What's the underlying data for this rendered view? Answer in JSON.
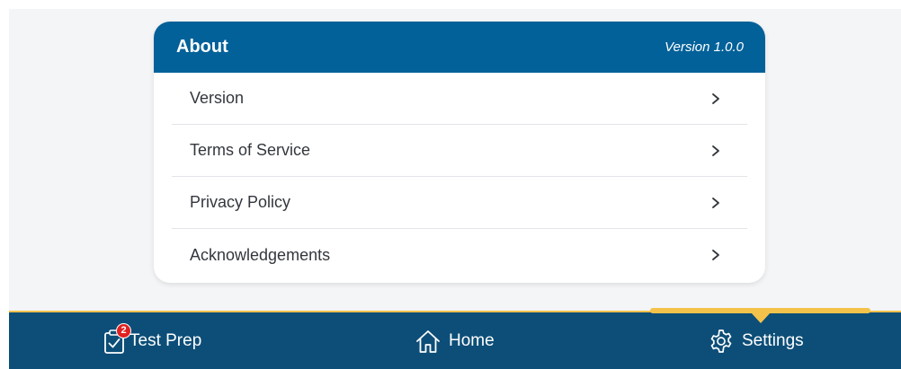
{
  "about_card": {
    "title": "About",
    "version_label": "Version 1.0.0",
    "items": [
      {
        "label": "Version"
      },
      {
        "label": "Terms of Service"
      },
      {
        "label": "Privacy Policy"
      },
      {
        "label": "Acknowledgements"
      }
    ]
  },
  "bottom_nav": {
    "items": [
      {
        "label": "Test Prep",
        "icon": "clipboard-check-icon",
        "badge": "2"
      },
      {
        "label": "Home",
        "icon": "home-icon"
      },
      {
        "label": "Settings",
        "icon": "gear-icon",
        "active": true
      }
    ]
  },
  "colors": {
    "header": "#036199",
    "nav_bar": "#0c4e78",
    "active_indicator": "#f4c24b",
    "badge": "#e02020"
  }
}
